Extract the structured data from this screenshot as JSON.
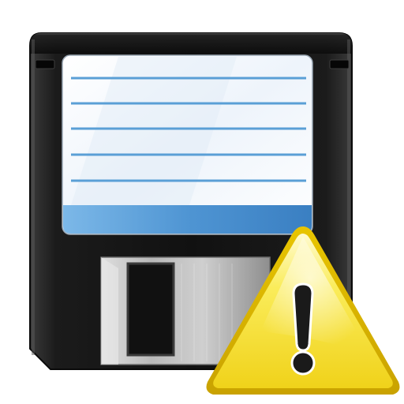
{
  "icon": {
    "name": "floppy-disk-warning-icon",
    "parts": [
      "floppy-disk-icon",
      "warning-triangle-icon",
      "exclamation-mark"
    ],
    "colors": {
      "disk_body": "#1e1e1e",
      "label_paper": "#ffffff",
      "label_lines": "#5a9fd6",
      "label_band": "#4f95d3",
      "shutter": "#b5b5b5",
      "warning_fill": "#f5e12a",
      "warning_edge": "#d6b400",
      "exclamation": "#1a1a1a"
    }
  }
}
